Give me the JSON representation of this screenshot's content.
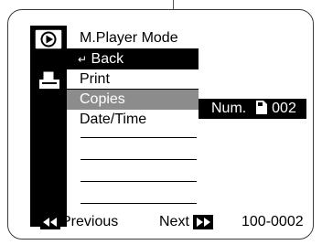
{
  "menu": {
    "title": "M.Player Mode",
    "back_arrow": "↵",
    "back_label": "Back",
    "items": [
      {
        "label": "Print"
      },
      {
        "label": "Copies"
      },
      {
        "label": "Date/Time"
      }
    ]
  },
  "copies_value": {
    "prefix": "Num.",
    "number": "002"
  },
  "footer": {
    "previous_label": "Previous",
    "next_label": "Next",
    "file_number": "100-0002"
  },
  "icons": {
    "mode": "play-mode-icon",
    "print": "printer-icon",
    "card": "memory-card-icon",
    "previous": "rewind-icon",
    "next": "fast-forward-icon"
  },
  "colors": {
    "highlight": "#000000",
    "selected": "#8c8c8c",
    "background": "#ffffff"
  }
}
